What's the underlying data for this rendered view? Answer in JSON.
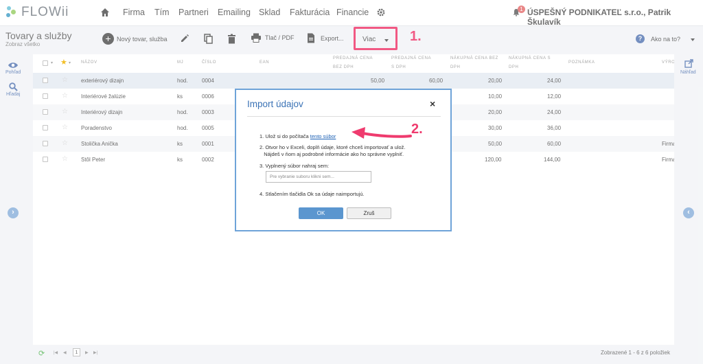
{
  "brand": {
    "name": "FLOWii"
  },
  "nav": {
    "items": [
      "Firma",
      "Tím",
      "Partneri",
      "Emailing",
      "Sklad",
      "Fakturácia",
      "Financie"
    ],
    "notification_count": "1",
    "company_user": "ÚSPEŠNÝ PODNIKATEĽ s.r.o., Patrik Škulavík"
  },
  "page": {
    "title": "Tovary a služby",
    "subtitle": "Zobraz všetko"
  },
  "toolbar": {
    "new_label": "Nový tovar, služba",
    "print_label": "Tlač / PDF",
    "export_label": "Export...",
    "more_label": "Viac",
    "help_label": "Ako na to?"
  },
  "side": {
    "view_label": "Pohľad",
    "search_label": "Hľadaj",
    "preview_label": "Náhľad"
  },
  "table": {
    "headers": {
      "name": "NÁZOV",
      "unit": "MJ",
      "number": "ČÍSLO",
      "ean": "EAN",
      "sale_net": [
        "PREDAJNÁ CENA",
        "BEZ DPH"
      ],
      "sale_gross": [
        "PREDAJNÁ CENA",
        "S DPH"
      ],
      "buy_net": [
        "NÁKUPNÁ CENA BEZ",
        "DPH"
      ],
      "buy_gross": [
        "NÁKUPNÁ CENA S",
        "DPH"
      ],
      "note": "POZNÁMKA",
      "producer": "VÝROBCA"
    },
    "rows": [
      {
        "name": "exteriérový dizajn",
        "unit": "hod.",
        "number": "0004",
        "sale_net": "50,00",
        "sale_gross": "60,00",
        "buy_net": "20,00",
        "buy_gross": "24,00",
        "producer": ""
      },
      {
        "name": "Interiérové žalúzie",
        "unit": "ks",
        "number": "0006",
        "sale_net": "",
        "sale_gross": "",
        "buy_net": "10,00",
        "buy_gross": "12,00",
        "producer": ""
      },
      {
        "name": "Interiérový dizajn",
        "unit": "hod.",
        "number": "0003",
        "sale_net": "",
        "sale_gross": "",
        "buy_net": "20,00",
        "buy_gross": "24,00",
        "producer": ""
      },
      {
        "name": "Poradenstvo",
        "unit": "hod.",
        "number": "0005",
        "sale_net": "",
        "sale_gross": "",
        "buy_net": "30,00",
        "buy_gross": "36,00",
        "producer": ""
      },
      {
        "name": "Stolička Anička",
        "unit": "ks",
        "number": "0001",
        "sale_net": "",
        "sale_gross": "",
        "buy_net": "50,00",
        "buy_gross": "60,00",
        "producer": "Firma"
      },
      {
        "name": "Stôl Peter",
        "unit": "ks",
        "number": "0002",
        "sale_net": "",
        "sale_gross": "",
        "buy_net": "120,00",
        "buy_gross": "144,00",
        "producer": "Firma"
      }
    ]
  },
  "footer": {
    "page": "1",
    "count_label": "Zobrazené 1 - 6 z 6 položiek"
  },
  "modal": {
    "title": "Import údajov",
    "close": "×",
    "step1_prefix": "1. Ulož si do počítača ",
    "step1_link": "tento súbor",
    "step2_line1": "2. Otvor ho v Exceli, doplň údaje, ktoré chceš importovať a ulož.",
    "step2_line2": "Nájdeš v ňom aj podrobné informácie ako ho správne vyplniť.",
    "step3": "3. Vyplnený súbor nahraj sem:",
    "file_placeholder": "Pre vybranie suboru klikni sem...",
    "step4": "4. Stlačením tlačidla Ok sa údaje naimportujú.",
    "ok": "OK",
    "cancel": "Zruš"
  },
  "annotations": {
    "mark1": "1.",
    "mark2": "2.",
    "mark_color": "#ef3b6e"
  }
}
